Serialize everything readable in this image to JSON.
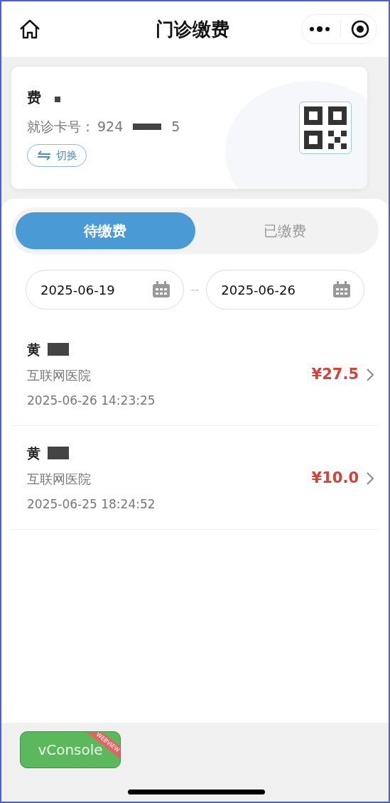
{
  "header": {
    "title": "门诊缴费"
  },
  "patient_card": {
    "name": "费",
    "card_label": "就诊卡号：",
    "card_number_start": "924",
    "card_number_end": "5",
    "switch_label": "切换"
  },
  "tabs": [
    {
      "label": "待缴费",
      "selected": true
    },
    {
      "label": "已缴费",
      "selected": false
    }
  ],
  "date_range": {
    "start": "2025-06-19",
    "separator": "--",
    "end": "2025-06-26"
  },
  "bills": [
    {
      "name": "黄",
      "hospital": "互联网医院",
      "time": "2025-06-26 14:23:25",
      "amount": "¥27.5"
    },
    {
      "name": "黄",
      "hospital": "互联网医院",
      "time": "2025-06-25 18:24:52",
      "amount": "¥10.0"
    }
  ],
  "vconsole": {
    "label": "vConsole",
    "ribbon": "WEBVIEW"
  }
}
